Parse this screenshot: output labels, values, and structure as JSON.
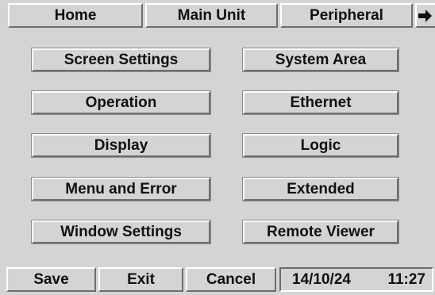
{
  "tabs": [
    {
      "label": "Home"
    },
    {
      "label": "Main Unit"
    },
    {
      "label": "Peripheral"
    }
  ],
  "tab_scroll_icon": "arrow-right-icon",
  "settings": {
    "left": [
      {
        "label": "Screen Settings"
      },
      {
        "label": "Operation"
      },
      {
        "label": "Display"
      },
      {
        "label": "Menu and Error"
      },
      {
        "label": "Window Settings"
      }
    ],
    "right": [
      {
        "label": "System Area"
      },
      {
        "label": "Ethernet"
      },
      {
        "label": "Logic"
      },
      {
        "label": "Extended"
      },
      {
        "label": "Remote Viewer"
      }
    ]
  },
  "footer": {
    "save_label": "Save",
    "exit_label": "Exit",
    "cancel_label": "Cancel",
    "date": "14/10/24",
    "time": "11:27"
  }
}
